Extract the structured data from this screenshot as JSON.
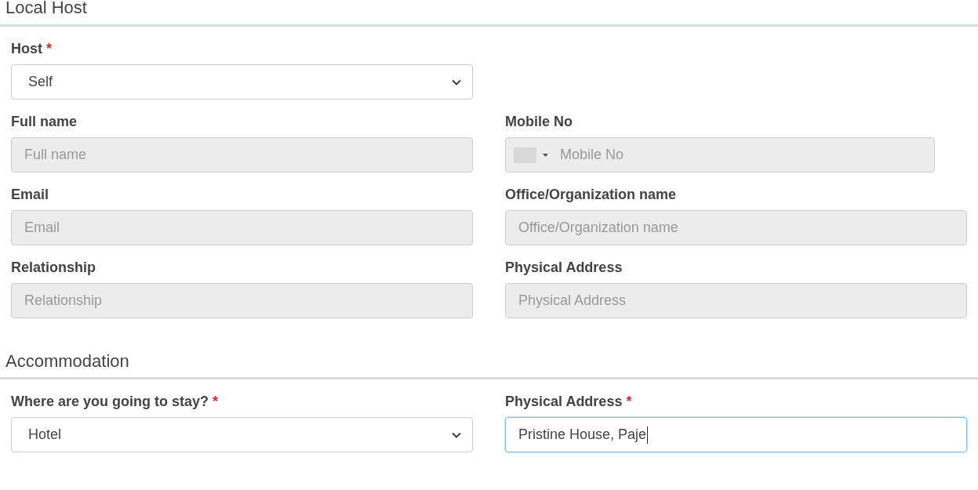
{
  "required_mark": "*",
  "sections": [
    {
      "title": "Local Host",
      "rows": [
        [
          {
            "label": "Host",
            "required": true,
            "kind": "select",
            "value": "Self",
            "disabled": false,
            "focused": false
          }
        ],
        [
          {
            "label": "Full name",
            "required": false,
            "kind": "text",
            "placeholder": "Full name",
            "disabled": true,
            "focused": false
          },
          {
            "label": "Mobile No",
            "required": false,
            "kind": "phone",
            "placeholder": "Mobile No",
            "disabled": true,
            "focused": false
          }
        ],
        [
          {
            "label": "Email",
            "required": false,
            "kind": "text",
            "placeholder": "Email",
            "disabled": true,
            "focused": false
          },
          {
            "label": "Office/Organization name",
            "required": false,
            "kind": "text",
            "placeholder": "Office/Organization name",
            "disabled": true,
            "focused": false
          }
        ],
        [
          {
            "label": "Relationship",
            "required": false,
            "kind": "text",
            "placeholder": "Relationship",
            "disabled": true,
            "focused": false
          },
          {
            "label": "Physical Address",
            "required": false,
            "kind": "text",
            "placeholder": "Physical Address",
            "disabled": true,
            "focused": false
          }
        ]
      ]
    },
    {
      "title": "Accommodation",
      "rows": [
        [
          {
            "label": "Where are you going to stay?",
            "required": true,
            "kind": "select",
            "value": "Hotel",
            "disabled": false,
            "focused": false
          },
          {
            "label": "Physical Address",
            "required": true,
            "kind": "text",
            "value": "Pristine House, Paje",
            "disabled": false,
            "focused": true
          }
        ]
      ]
    }
  ]
}
